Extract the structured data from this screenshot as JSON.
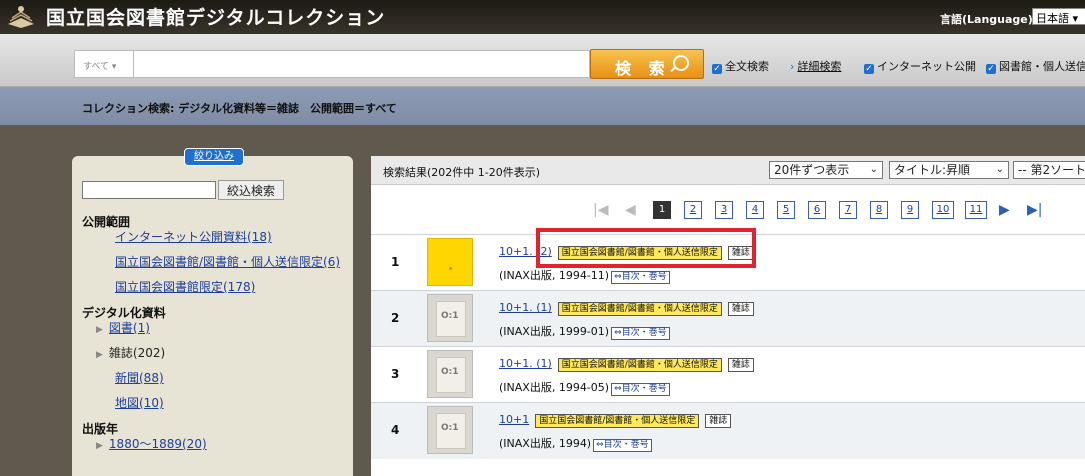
{
  "header": {
    "site_title": "国立国会図書館デジタルコレクション",
    "logo_icon": "ndl-book-logo-icon",
    "language_label": "言語(Language):",
    "language_value": "日本語 ▾"
  },
  "search": {
    "scope": "すべて ▾",
    "query": "",
    "button_label": "検 索",
    "options": [
      {
        "label": "全文検索",
        "checked": true
      },
      {
        "label": "インターネット公開",
        "checked": true
      },
      {
        "label": "図書館・個人送信",
        "checked": true
      }
    ],
    "advanced_link": "詳細検索",
    "advanced_arrow": "›"
  },
  "banner": {
    "text": "コレクション検索: デジタル化資料等＝雑誌　公開範囲＝すべて"
  },
  "sidebar": {
    "refine_tab": "絞り込み",
    "refine_button": "絞込検索",
    "access_heading": "公開範囲",
    "access_items": [
      "インターネット公開資料(18)",
      "国立国会図書館/図書館・個人送信限定(6)",
      "国立国会図書館限定(178)"
    ],
    "digital_heading": "デジタル化資料",
    "digital_items": [
      {
        "label": "図書(1)",
        "link": true,
        "arrow": "▶"
      },
      {
        "label": "雑誌(202)",
        "link": false,
        "arrow": "▶"
      },
      {
        "label": "新聞(88)",
        "link": true,
        "arrow": ""
      },
      {
        "label": "地図(10)",
        "link": true,
        "arrow": ""
      }
    ],
    "year_heading": "出版年",
    "year_items": [
      {
        "label": "1880～1889(20)",
        "arrow": "▶"
      }
    ]
  },
  "results": {
    "count_text": "検索結果(202件中 1-20件表示)",
    "per_page": "20件ずつ表示",
    "sort1": "タイトル:昇順",
    "sort2": "-- 第2ソート",
    "pager": {
      "first": "|◀",
      "prev": "◀",
      "pages": [
        "1",
        "2",
        "3",
        "4",
        "5",
        "6",
        "7",
        "8",
        "9",
        "10",
        "11"
      ],
      "current": "1",
      "next": "▶",
      "last": "▶|"
    },
    "rows": [
      {
        "num": "1",
        "title": "10+1. (2)",
        "access": "国立国会図書館/図書館・個人送信限定",
        "type": "雑誌",
        "pub": "(INAX出版, 1994-11)",
        "toc": "⇔目次・巻号",
        "thumb": "yellow"
      },
      {
        "num": "2",
        "title": "10+1. (1)",
        "access": "国立国会図書館/図書館・個人送信限定",
        "type": "雑誌",
        "pub": "(INAX出版, 1999-01)",
        "toc": "⇔目次・巻号",
        "thumb": "gray"
      },
      {
        "num": "3",
        "title": "10+1. (1)",
        "access": "国立国会図書館/図書館・個人送信限定",
        "type": "雑誌",
        "pub": "(INAX出版, 1994-05)",
        "toc": "⇔目次・巻号",
        "thumb": "gray"
      },
      {
        "num": "4",
        "title": "10+1",
        "access": "国立国会図書館/図書館・個人送信限定",
        "type": "雑誌",
        "pub": "(INAX出版, 1994)",
        "toc": "⇔目次・巻号",
        "thumb": "gray"
      }
    ]
  },
  "colors": {
    "highlight": "#e0242e",
    "search_button": "#f0a020",
    "banner": "#8793ab",
    "access_badge": "#ffe95b"
  }
}
